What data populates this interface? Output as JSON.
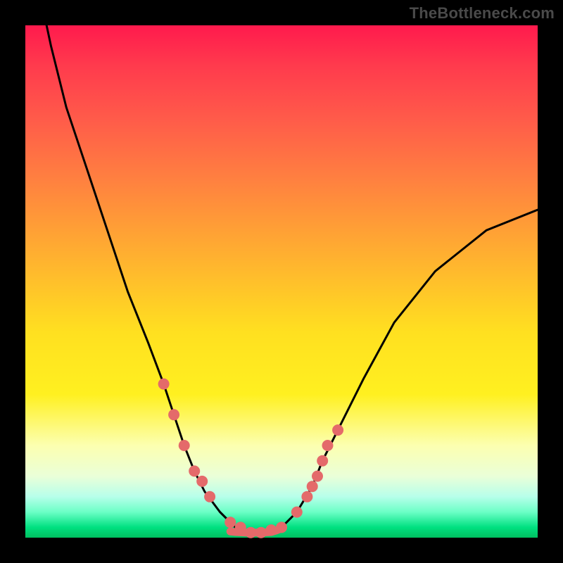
{
  "watermark": "TheBottleneck.com",
  "chart_data": {
    "type": "line",
    "title": "",
    "xlabel": "",
    "ylabel": "",
    "xlim": [
      0,
      100
    ],
    "ylim": [
      0,
      100
    ],
    "series": [
      {
        "name": "bottleneck-curve",
        "x": [
          2,
          5,
          8,
          12,
          16,
          20,
          24,
          27,
          29,
          31,
          33,
          35,
          38,
          41,
          44,
          47,
          50,
          53,
          56,
          58,
          61,
          66,
          72,
          80,
          90,
          100
        ],
        "values": [
          110,
          96,
          84,
          72,
          60,
          48,
          38,
          30,
          24,
          18,
          13,
          9,
          5,
          2,
          1,
          1,
          2,
          5,
          10,
          15,
          21,
          31,
          42,
          52,
          60,
          64
        ]
      }
    ],
    "markers": {
      "name": "highlight-dots",
      "color": "#e46a6a",
      "x": [
        27,
        29,
        31,
        33,
        34.5,
        36,
        40,
        42,
        44,
        46,
        48,
        50,
        53,
        55,
        56,
        57,
        58,
        59,
        61
      ],
      "values": [
        30,
        24,
        18,
        13,
        11,
        8,
        3,
        2,
        1,
        1,
        1.5,
        2,
        5,
        8,
        10,
        12,
        15,
        18,
        21
      ]
    },
    "flat_band": {
      "x": [
        40,
        41,
        42,
        43,
        44,
        45,
        46,
        47,
        48,
        49,
        50
      ],
      "values": [
        1.2,
        1.1,
        1.05,
        1.0,
        1.0,
        1.0,
        1.0,
        1.05,
        1.1,
        1.4,
        1.8
      ],
      "color": "#e46a6a"
    },
    "gradient_stops": [
      {
        "pct": 0,
        "color": "#ff1a4d"
      },
      {
        "pct": 18,
        "color": "#ff5a4a"
      },
      {
        "pct": 45,
        "color": "#ffb030"
      },
      {
        "pct": 72,
        "color": "#fff020"
      },
      {
        "pct": 88,
        "color": "#eaffd8"
      },
      {
        "pct": 95,
        "color": "#6bffc6"
      },
      {
        "pct": 100,
        "color": "#00c060"
      }
    ]
  }
}
